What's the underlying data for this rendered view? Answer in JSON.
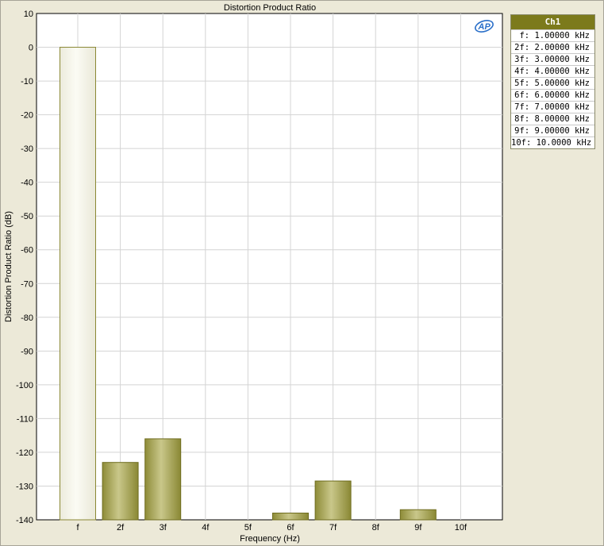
{
  "chart_data": {
    "type": "bar",
    "title": "Distortion Product Ratio",
    "xlabel": "Frequency (Hz)",
    "ylabel": "Distortion Product Ratio (dB)",
    "ylim": [
      -140,
      10
    ],
    "yticks": [
      "10",
      "0",
      "-10",
      "-20",
      "-30",
      "-40",
      "-50",
      "-60",
      "-70",
      "-80",
      "-90",
      "-100",
      "-110",
      "-120",
      "-130",
      "-140"
    ],
    "categories": [
      "f",
      "2f",
      "3f",
      "4f",
      "5f",
      "6f",
      "7f",
      "8f",
      "9f",
      "10f"
    ],
    "series": [
      {
        "name": "Ch1",
        "values": [
          0,
          -123,
          -116,
          null,
          null,
          -138,
          -128.5,
          null,
          -137,
          null
        ]
      }
    ],
    "grid": true,
    "legend_position": "right"
  },
  "legend": {
    "header": "Ch1",
    "rows": [
      "f: 1.00000 kHz",
      "2f: 2.00000 kHz",
      "3f: 3.00000 kHz",
      "4f: 4.00000 kHz",
      "5f: 5.00000 kHz",
      "6f: 6.00000 kHz",
      "7f: 7.00000 kHz",
      "8f: 8.00000 kHz",
      "9f: 9.00000 kHz",
      "10f: 10.0000 kHz"
    ]
  },
  "colors": {
    "bar_fill": "#9c9a48",
    "bar_stroke": "#6f6d20",
    "fundamental_fill": "#f3f2e6",
    "legend_header": "#7c7a1c",
    "logo": "#2a6fc9"
  },
  "logo_icon": "ap-logo-icon"
}
